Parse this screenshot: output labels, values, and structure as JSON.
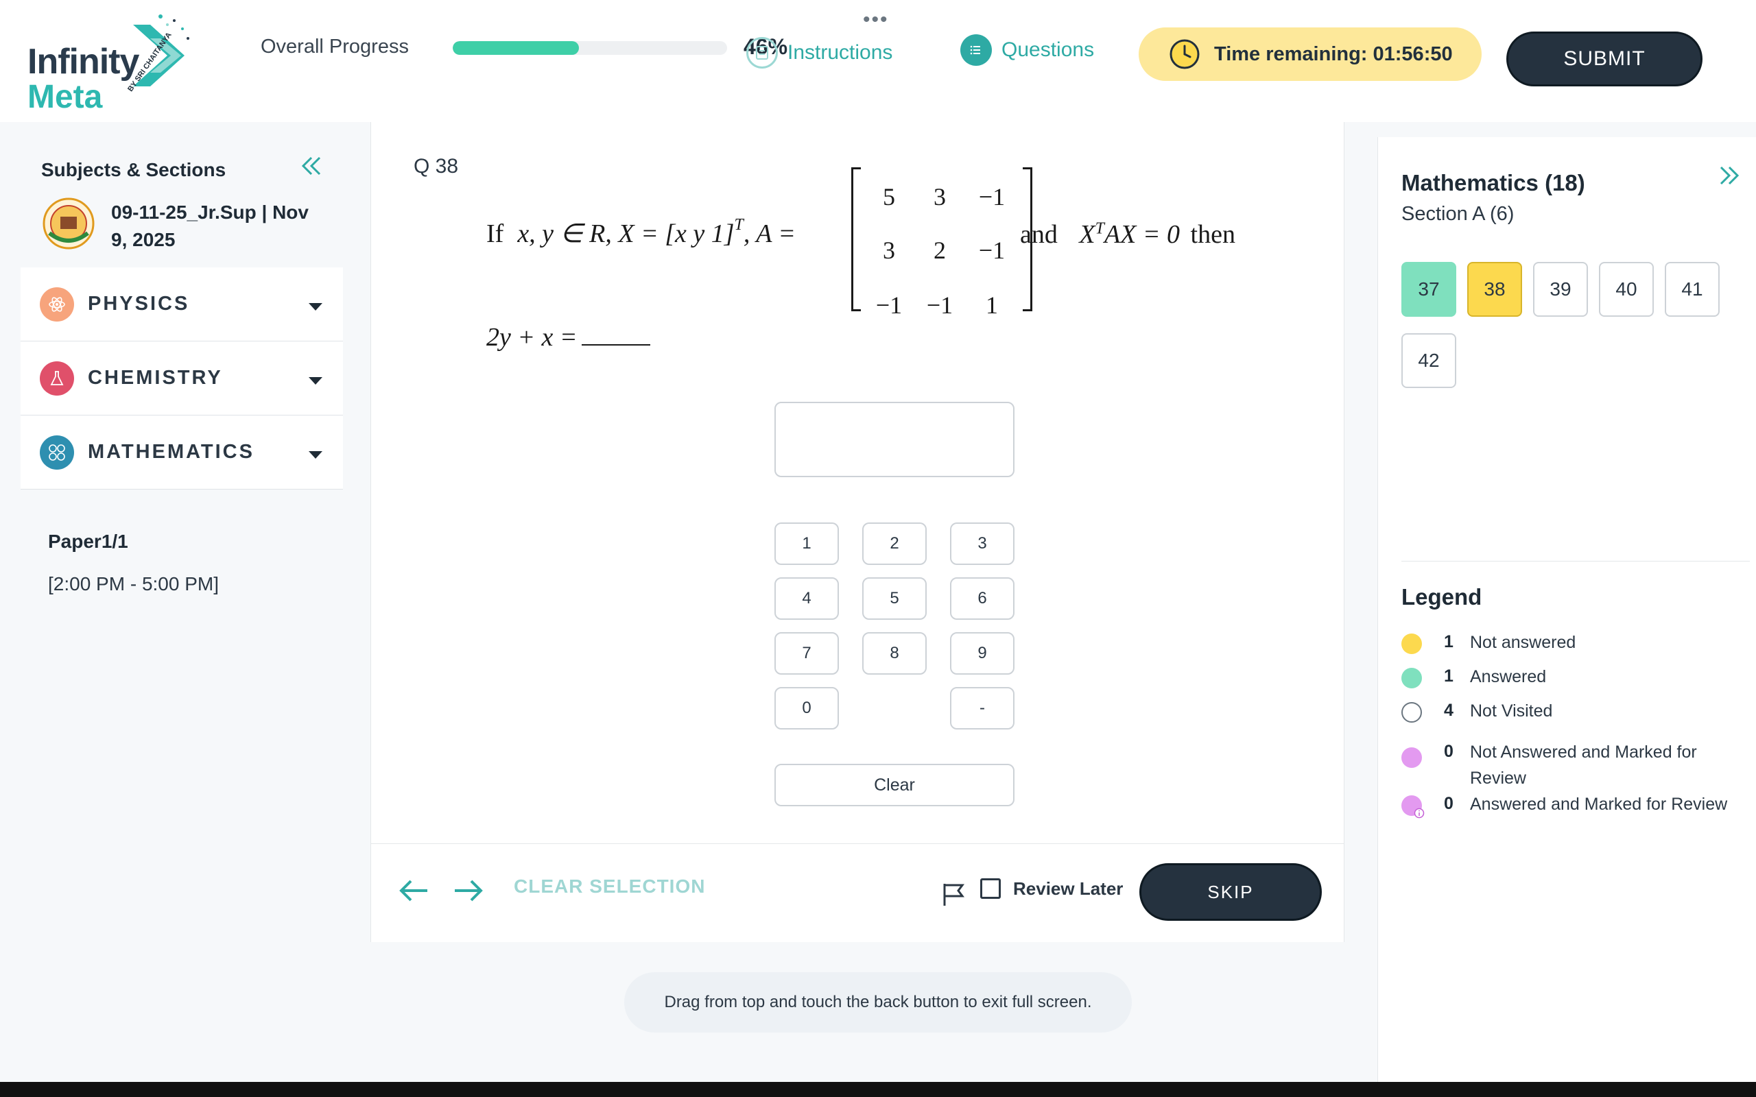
{
  "header": {
    "brand_top": "Infinity",
    "brand_bottom": "Meta",
    "brand_by": "BY SRI CHAITANYA",
    "progress_label": "Overall Progress",
    "progress_percent": 46,
    "progress_text": "46%",
    "instructions_label": "Instructions",
    "questions_label": "Questions",
    "timer_text": "Time remaining: 01:56:50",
    "submit_label": "SUBMIT"
  },
  "sidebar": {
    "title": "Subjects & Sections",
    "paper_title": "09-11-25_Jr.Sup | Nov 9, 2025",
    "subjects": [
      {
        "label": "PHYSICS",
        "color": "#f7a47c"
      },
      {
        "label": "CHEMISTRY",
        "color": "#e0506a"
      },
      {
        "label": "MATHEMATICS",
        "color": "#2e8fb0"
      }
    ],
    "paper_name": "Paper1/1",
    "paper_time": "[2:00 PM - 5:00 PM]"
  },
  "question": {
    "number": "Q 38",
    "prefix": "If",
    "vars": "x, y ∈ R, X = [x   y   1]",
    "sup_t": "T",
    "comma_a": ", A =",
    "matrix": [
      [
        "5",
        "3",
        "−1"
      ],
      [
        "3",
        "2",
        "−1"
      ],
      [
        "−1",
        "−1",
        "1"
      ]
    ],
    "and_text": "and",
    "condition": "X",
    "condition_rest": "AX = 0",
    "then_text": "then",
    "asked": "2y + x =",
    "keypad": [
      "1",
      "2",
      "3",
      "4",
      "5",
      "6",
      "7",
      "8",
      "9",
      "0",
      "-"
    ],
    "clear_label": "Clear"
  },
  "footer": {
    "clear_selection_label": "CLEAR SELECTION",
    "review_label": "Review Later",
    "skip_label": "SKIP"
  },
  "toast": "Drag from top and touch the back button to exit full screen.",
  "right_panel": {
    "subject_title": "Mathematics (18)",
    "section_title": "Section A (6)",
    "questions": [
      {
        "num": "37",
        "status": "answered"
      },
      {
        "num": "38",
        "status": "current"
      },
      {
        "num": "39",
        "status": "not-visited"
      },
      {
        "num": "40",
        "status": "not-visited"
      },
      {
        "num": "41",
        "status": "not-visited"
      },
      {
        "num": "42",
        "status": "not-visited"
      }
    ],
    "legend_title": "Legend",
    "legend": [
      {
        "count": "1",
        "label": "Not answered",
        "color": "#fcd94e"
      },
      {
        "count": "1",
        "label": "Answered",
        "color": "#7fe0be"
      },
      {
        "count": "4",
        "label": "Not Visited",
        "color": "#ffffff"
      },
      {
        "count": "0",
        "label": "Not Answered and Marked for Review",
        "color": "#e39af0"
      },
      {
        "count": "0",
        "label": "Answered and Marked for Review",
        "color": "#e39af0"
      }
    ]
  },
  "colors": {
    "accent": "#2eaaa4",
    "dark": "#25323f",
    "timer_bg": "#fde89a"
  }
}
